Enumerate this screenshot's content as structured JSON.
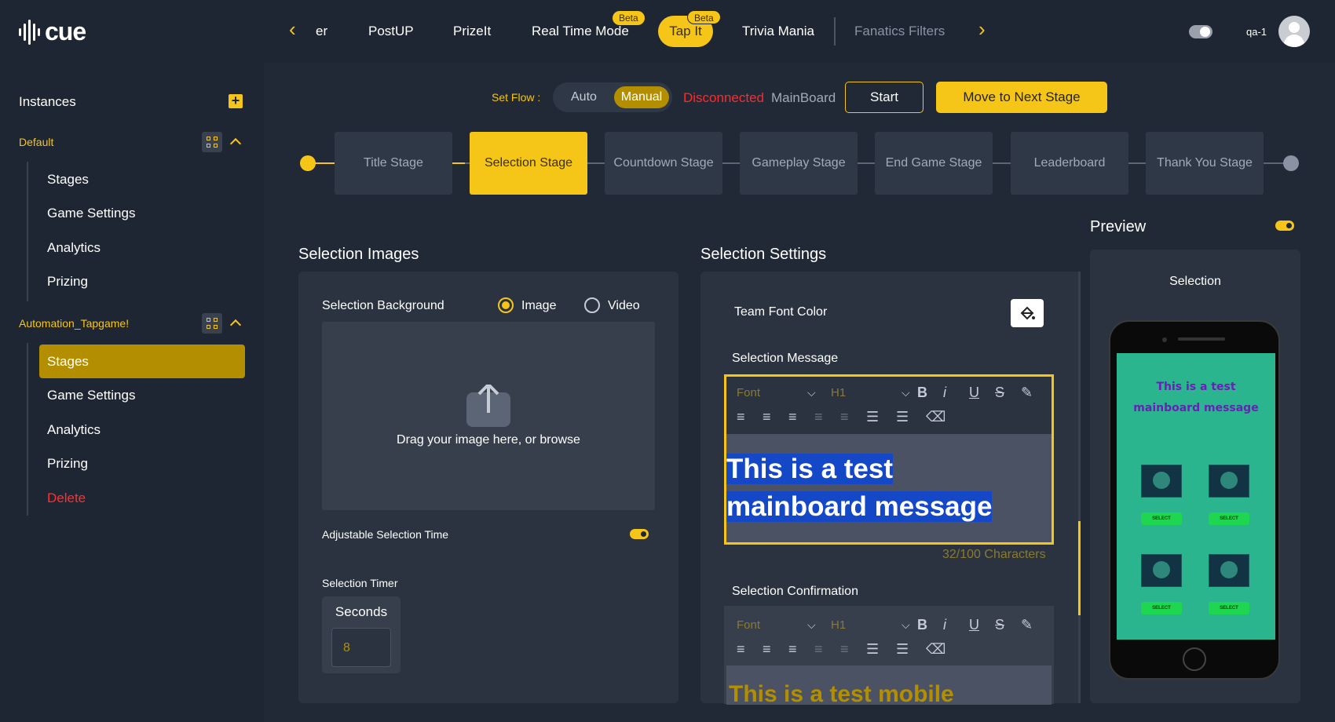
{
  "brand": {
    "logo_text": "cue"
  },
  "topnav": {
    "items": [
      "er",
      "PostUP",
      "PrizeIt",
      "Real Time Mode",
      "Tap It",
      "Trivia Mania",
      "Fanatics Filters"
    ],
    "beta_label": "Beta",
    "active_item": "Tap It",
    "user_name": "qa-1"
  },
  "sidebar": {
    "title": "Instances",
    "groups": [
      {
        "name": "Default",
        "items": [
          "Stages",
          "Game Settings",
          "Analytics",
          "Prizing"
        ]
      },
      {
        "name": "Automation_Tapgame!",
        "items": [
          "Stages",
          "Game Settings",
          "Analytics",
          "Prizing",
          "Delete"
        ],
        "active": "Stages"
      }
    ]
  },
  "flow": {
    "set_flow_label": "Set Flow :",
    "options": [
      "Auto",
      "Manual"
    ],
    "selected": "Manual",
    "status": "Disconnected",
    "board": "MainBoard",
    "start_label": "Start",
    "next_label": "Move to Next Stage"
  },
  "stages": [
    "Title Stage",
    "Selection Stage",
    "Countdown Stage",
    "Gameplay Stage",
    "End Game Stage",
    "Leaderboard",
    "Thank You Stage"
  ],
  "active_stage": "Selection Stage",
  "images_panel": {
    "title": "Selection Images",
    "background_label": "Selection Background",
    "radio_image": "Image",
    "radio_video": "Video",
    "selected_media": "Image",
    "drop_text": "Drag your image here, or browse",
    "adjustable_label": "Adjustable Selection Time",
    "adjustable_on": true,
    "timer_label": "Selection Timer",
    "timer_unit": "Seconds",
    "timer_value": "8"
  },
  "settings_panel": {
    "title": "Selection Settings",
    "team_font_label": "Team Font Color",
    "message_label": "Selection Message",
    "font_placeholder": "Font",
    "heading_value": "H1",
    "message_text": "This is a test mainboard message",
    "char_count": "32/100 Characters",
    "confirmation_label": "Selection Confirmation",
    "confirmation_text": "This is a test mobile"
  },
  "preview": {
    "title": "Preview",
    "toggle_on": true,
    "screen_title": "Selection",
    "message": "This is a test mainboard message",
    "select_label": "SELECT"
  },
  "colors": {
    "accent": "#f5c518",
    "danger": "#ff2a2a",
    "bg": "#212936",
    "panel": "#2b3340"
  }
}
